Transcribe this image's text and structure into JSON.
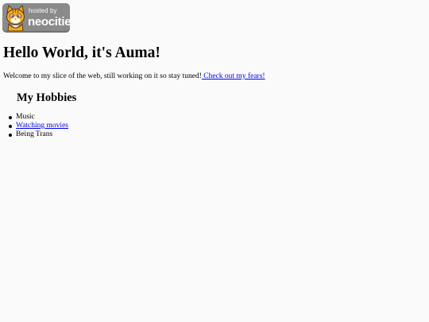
{
  "badge": {
    "hosted_label": "hosted by",
    "brand_label": "neocities",
    "bg_color": "#8a8a8a",
    "icon": "neocities-cat-icon"
  },
  "heading": "Hello World, it's Auma!",
  "intro": {
    "text": "Welcome to my slice of the web, still working on it so stay tuned!",
    "link_label": " Check out my fears!"
  },
  "hobbies": {
    "title": "My Hobbies",
    "items": [
      {
        "label": "Music",
        "is_link": false
      },
      {
        "label": "Watching movies",
        "is_link": true
      },
      {
        "label": "Being Trans",
        "is_link": false
      }
    ]
  },
  "colors": {
    "link": "#0000ee",
    "background": "#fafafa"
  }
}
